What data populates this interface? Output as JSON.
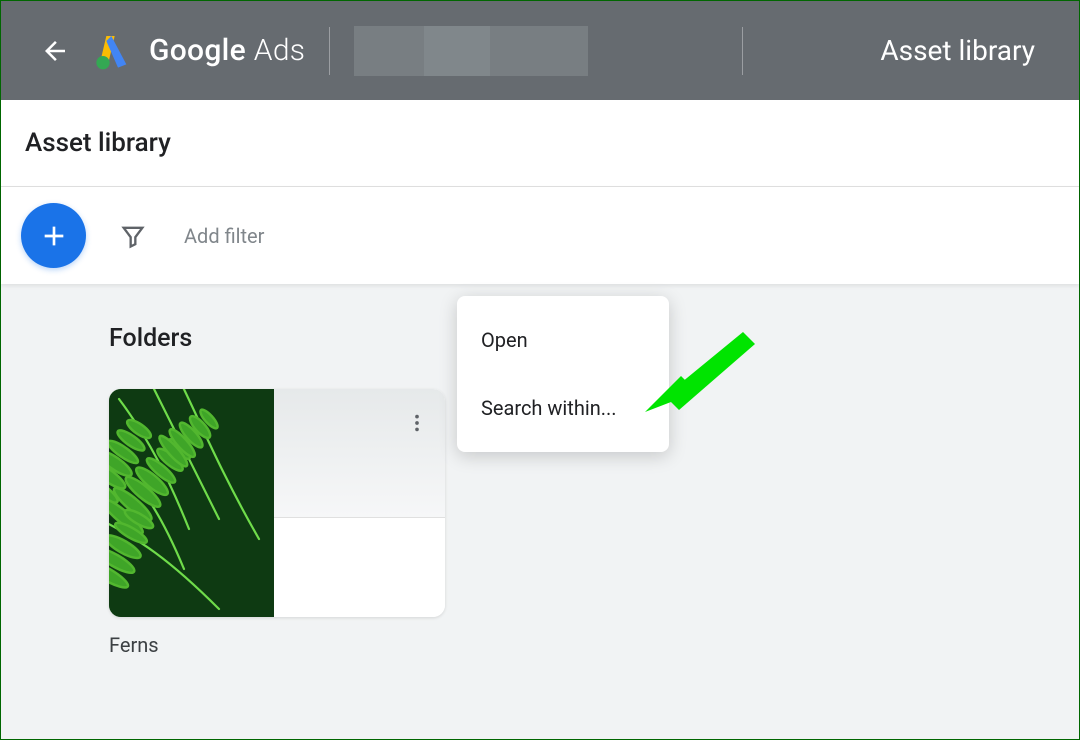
{
  "header": {
    "product_name_bold": "Google",
    "product_name_light": "Ads",
    "breadcrumb": "Asset library"
  },
  "page": {
    "title": "Asset library",
    "filter_placeholder": "Add filter",
    "section_title": "Folders"
  },
  "folder": {
    "name": "Ferns"
  },
  "menu": {
    "items": [
      "Open",
      "Search within..."
    ]
  },
  "colors": {
    "primary": "#1a73e8",
    "annotation": "#00e400"
  }
}
